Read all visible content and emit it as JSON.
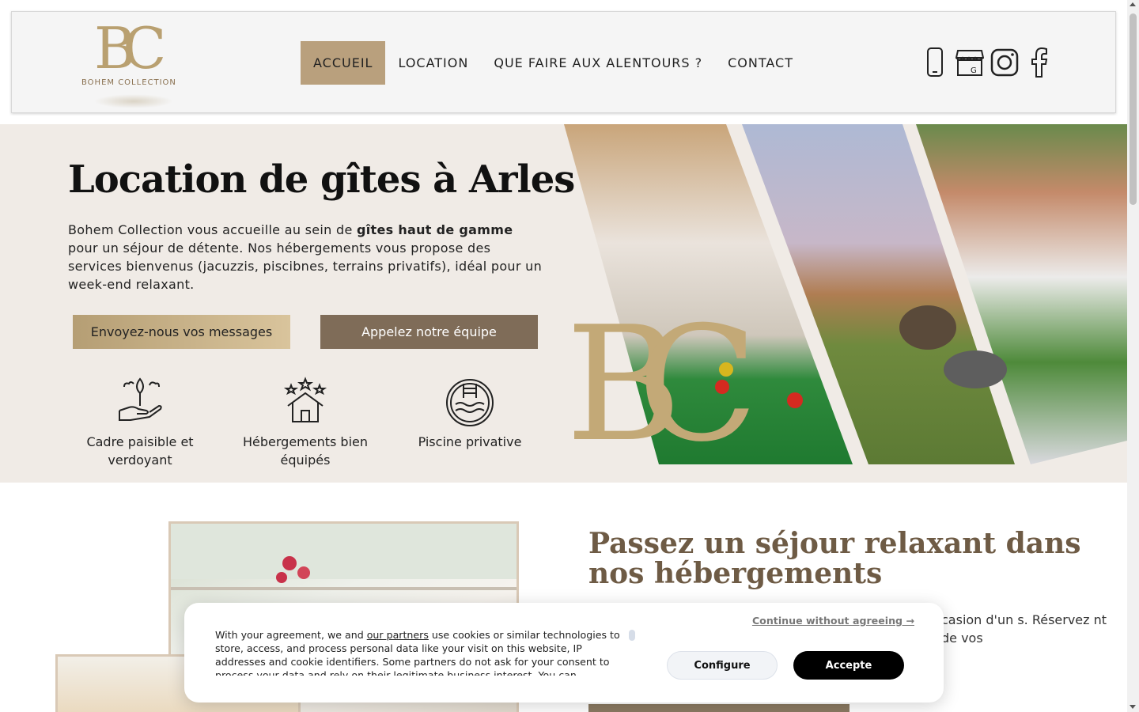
{
  "header": {
    "logo_text": "BOHEM COLLECTION",
    "logo_monogram": "BC",
    "nav": [
      {
        "label": "ACCUEIL",
        "active": true
      },
      {
        "label": "LOCATION",
        "active": false
      },
      {
        "label": "QUE FAIRE AUX ALENTOURS ?",
        "active": false
      },
      {
        "label": "CONTACT",
        "active": false
      }
    ],
    "social_icons": [
      "phone-icon",
      "google-business-icon",
      "instagram-icon",
      "facebook-icon"
    ]
  },
  "hero": {
    "title": "Location de gîtes à Arles",
    "text_before": "Bohem Collection vous accueille au sein de ",
    "text_bold": "gîtes haut de gamme",
    "text_after": " pour un séjour de détente. Nos hébergements vous propose des services bienvenus (jacuzzis, piscibnes, terrains privatifs), idéal pour un week-end relaxant.",
    "button_message": "Envoyez-nous vos messages",
    "button_call": "Appelez notre équipe",
    "features": [
      {
        "icon": "plant-hand-icon",
        "label": "Cadre paisible et verdoyant"
      },
      {
        "icon": "stars-house-icon",
        "label": "Hébergements bien équipés"
      },
      {
        "icon": "pool-icon",
        "label": "Piscine privative"
      }
    ]
  },
  "section2": {
    "title": "Passez un séjour relaxant dans nos hébergements",
    "text": "casion d'un s. Réservez nt de vos"
  },
  "cookie": {
    "text_before_link": "With your agreement, we and ",
    "link": "our partners",
    "text_after_link": " use cookies or similar technologies to store, access, and process personal data like your visit on this website, IP addresses and cookie identifiers. Some partners do not ask for your consent to process your data and rely on their legitimate business interest. You can",
    "continue": "Continue without agreeing →",
    "configure": "Configure",
    "accept": "Accepte"
  },
  "colors": {
    "accent_gold": "#b9a07d",
    "hero_bg": "#f0ebe6",
    "title_brown": "#6e5b45",
    "call_button": "#7f6c58"
  }
}
